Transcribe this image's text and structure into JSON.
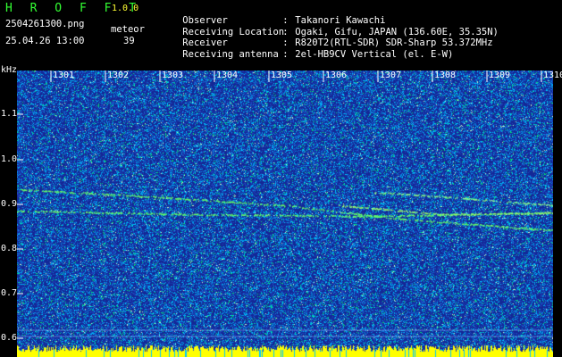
{
  "app": {
    "name": "H R O F F T",
    "version": "1.0.0",
    "filename": "2504261300.png",
    "datetime": "25.04.26 13:00",
    "meteor_label": "meteor",
    "meteor_count": "39"
  },
  "info": [
    {
      "label": "Observer",
      "value": "Takanori Kawachi"
    },
    {
      "label": "Receiving Location",
      "value": "Ogaki, Gifu, JAPAN (136.60E, 35.35N)"
    },
    {
      "label": "Receiver",
      "value": "R820T2(RTL-SDR) SDR-Sharp 53.372MHz"
    },
    {
      "label": "Receiving antenna",
      "value": "2el-HB9CV Vertical (el. E-W)"
    }
  ],
  "colon": ":",
  "axis": {
    "unit": "kHz",
    "y_ticks": [
      "1.1",
      "1.0",
      "0.9",
      "0.8",
      "0.7",
      "0.6"
    ],
    "x_ticks": [
      "1301",
      "1302",
      "1303",
      "1304",
      "1305",
      "1306",
      "1307",
      "1308",
      "1309",
      "1310"
    ]
  },
  "colors": {
    "background": "#000000",
    "spectrum_base": "#0a1f8f",
    "noise_cyan": "#00c8ff",
    "noise_green": "#00ff66",
    "baseline_yellow": "#ffff00",
    "header_green": "#33ff33",
    "header_yellow": "#ffff33"
  }
}
